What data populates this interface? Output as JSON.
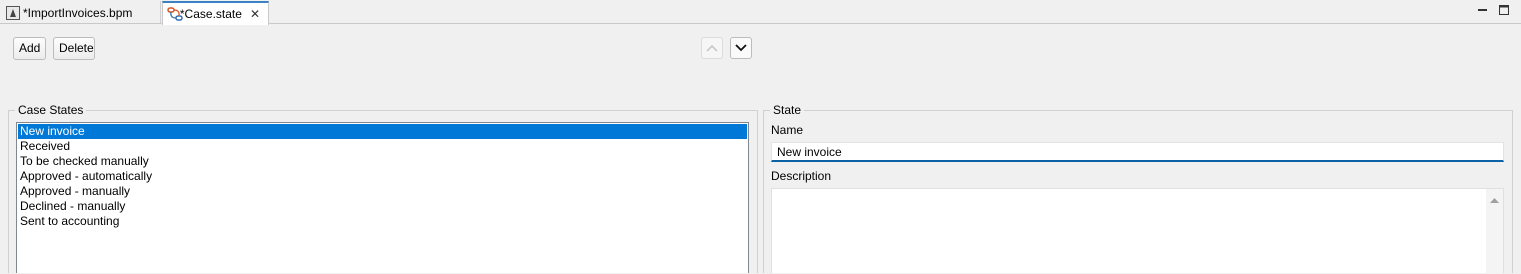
{
  "tabs": [
    {
      "label": "*ImportInvoices.bpm",
      "icon": "bpm-file-icon",
      "active": false
    },
    {
      "label": "*Case.state",
      "icon": "state-file-icon",
      "active": true
    }
  ],
  "toolbar": {
    "add_label": "Add",
    "delete_label": "Delete"
  },
  "case_states": {
    "title": "Case States",
    "items": [
      "New invoice",
      "Received",
      "To be checked manually",
      "Approved - automatically",
      "Approved - manually",
      "Declined - manually",
      "Sent to accounting"
    ],
    "selected_index": 0
  },
  "state": {
    "title": "State",
    "name_label": "Name",
    "name_value": "New invoice",
    "description_label": "Description",
    "description_value": ""
  },
  "colors": {
    "selection": "#0078d7",
    "active_tab_accent": "#3b82c4",
    "input_focus_underline": "#0b62a4"
  }
}
